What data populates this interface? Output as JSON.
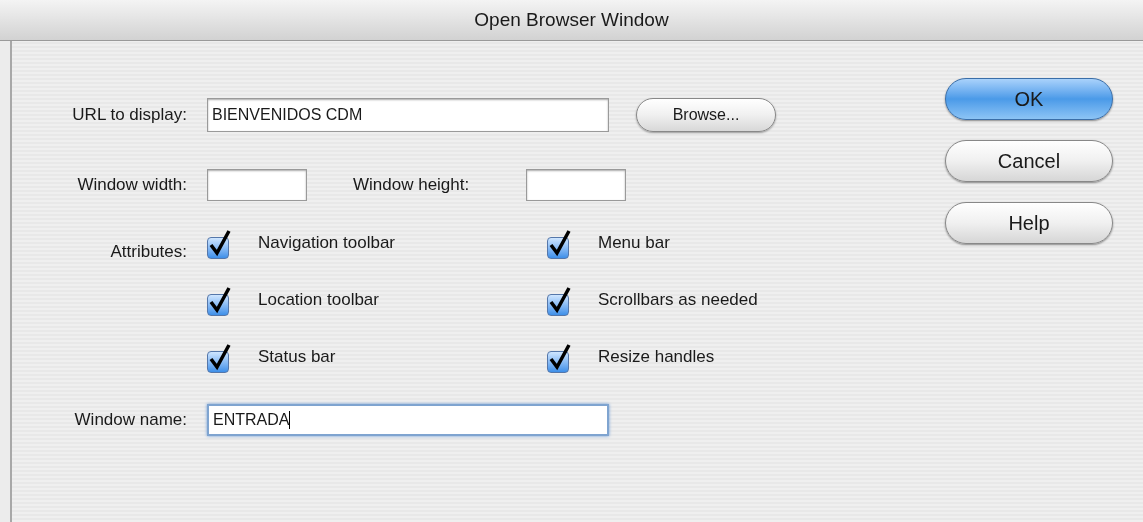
{
  "window": {
    "title": "Open Browser Window"
  },
  "url_field": {
    "label": "URL to display:",
    "value": "BIENVENIDOS CDM",
    "focused": false
  },
  "browse_button": {
    "label": "Browse..."
  },
  "width_field": {
    "label": "Window width:",
    "focused": false
  },
  "height_field": {
    "label": "Window height:",
    "focused": false
  },
  "attributes": {
    "label": "Attributes:",
    "options": [
      {
        "label": "Navigation toolbar",
        "checked": true
      },
      {
        "label": "Menu bar",
        "checked": true
      },
      {
        "label": "Location toolbar",
        "checked": true
      },
      {
        "label": "Scrollbars as needed",
        "checked": true
      },
      {
        "label": "Status bar",
        "checked": true
      },
      {
        "label": "Resize handles",
        "checked": true
      }
    ]
  },
  "name_field": {
    "label": "Window name:",
    "value": "ENTRADA",
    "focused": true
  },
  "buttons": [
    {
      "label": "OK",
      "default": true
    },
    {
      "label": "Cancel",
      "default": false
    },
    {
      "label": "Help",
      "default": false
    }
  ]
}
